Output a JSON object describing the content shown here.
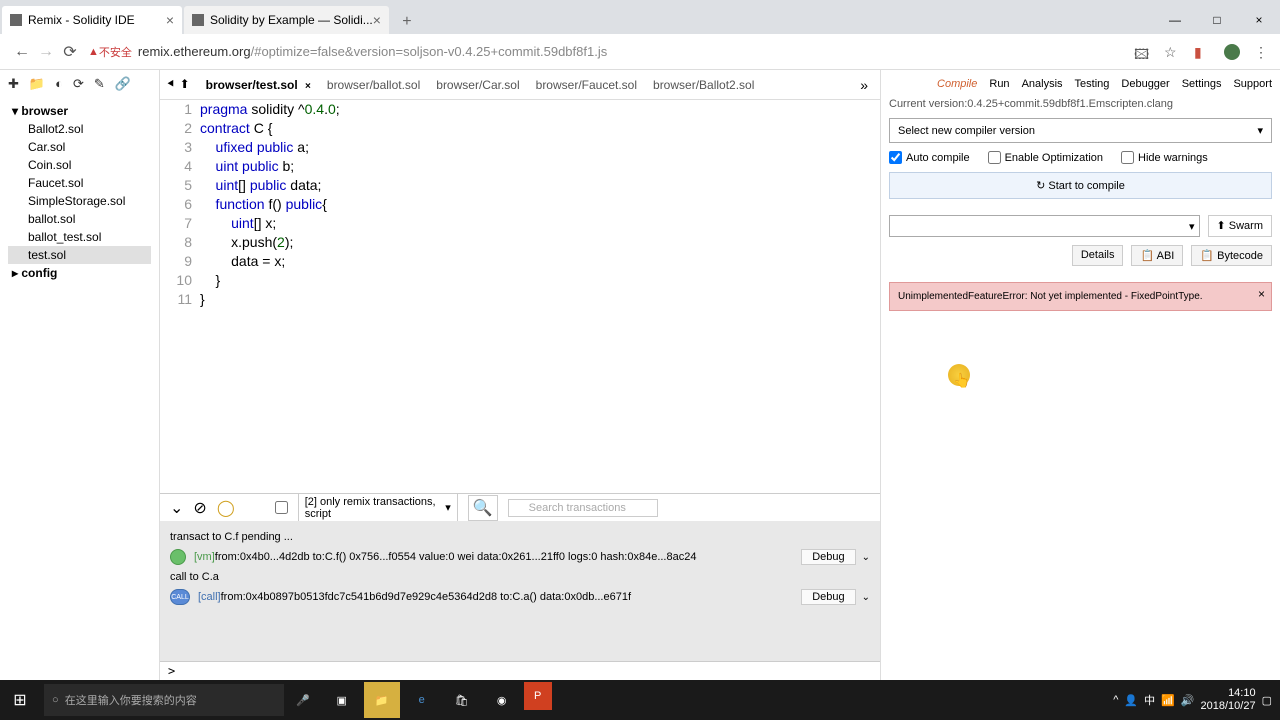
{
  "browser": {
    "tabs": [
      {
        "title": "Remix - Solidity IDE"
      },
      {
        "title": "Solidity by Example — Solidi..."
      }
    ],
    "security": "不安全",
    "url_domain": "remix.ethereum.org",
    "url_path": "/#optimize=false&version=soljson-v0.4.25+commit.59dbf8f1.js"
  },
  "window": {
    "min": "—",
    "max": "□",
    "close": "×"
  },
  "tree": {
    "folder1": "browser",
    "files": [
      "Ballot2.sol",
      "Car.sol",
      "Coin.sol",
      "Faucet.sol",
      "SimpleStorage.sol",
      "ballot.sol",
      "ballot_test.sol",
      "test.sol"
    ],
    "folder2": "config"
  },
  "file_tabs": [
    "browser/test.sol",
    "browser/ballot.sol",
    "browser/Car.sol",
    "browser/Faucet.sol",
    "browser/Ballot2.sol"
  ],
  "right_tabs": [
    "Compile",
    "Run",
    "Analysis",
    "Testing",
    "Debugger",
    "Settings",
    "Support"
  ],
  "code": {
    "l1_a": "pragma",
    "l1_b": " solidity ^",
    "l1_c": "0.4",
    "l1_d": ".",
    "l1_e": "0",
    "l1_f": ";",
    "l2_a": "contract",
    "l2_b": " C {",
    "l3_a": "    ufixed",
    "l3_b": " ",
    "l3_c": "public",
    "l3_d": " a;",
    "l4_a": "    uint",
    "l4_b": " ",
    "l4_c": "public",
    "l4_d": " b;",
    "l5_a": "    uint",
    "l5_b": "[] ",
    "l5_c": "public",
    "l5_d": " data;",
    "l6_a": "    function",
    "l6_b": " f() ",
    "l6_c": "public",
    "l6_d": "{",
    "l7_a": "        uint",
    "l7_b": "[] x;",
    "l8": "        x.push(",
    "l8_b": "2",
    "l8_c": ");",
    "l9": "        data = x;",
    "l10": "    }",
    "l11": "}"
  },
  "terminal": {
    "filter": "[2] only remix transactions, script",
    "search_placeholder": "Search transactions",
    "line1": "transact to C.f pending ...",
    "row1_vm": "[vm]",
    "row1_text": " from:0x4b0...4d2db to:C.f() 0x756...f0554 value:0 wei data:0x261...21ff0 logs:0 hash:0x84e...8ac24",
    "line2": "call to C.a",
    "row2_call": "[call]",
    "row2_text": " from:0x4b0897b0513fdc7c541b6d9d7e929c4e5364d2d8 to:C.a() data:0x0db...e671f",
    "debug": "Debug",
    "prompt": ">"
  },
  "compile_panel": {
    "version": "Current version:0.4.25+commit.59dbf8f1.Emscripten.clang",
    "select": "Select new compiler version",
    "auto": "Auto compile",
    "opt": "Enable Optimization",
    "hide": "Hide warnings",
    "start": "↻ Start to compile",
    "swarm": "⬆ Swarm",
    "details": "Details",
    "abi": "📋 ABI",
    "bytecode": "📋 Bytecode",
    "error": "UnimplementedFeatureError: Not yet implemented - FixedPointType."
  },
  "taskbar": {
    "search": "在这里输入你要搜索的内容",
    "time": "14:10",
    "date": "2018/10/27"
  }
}
